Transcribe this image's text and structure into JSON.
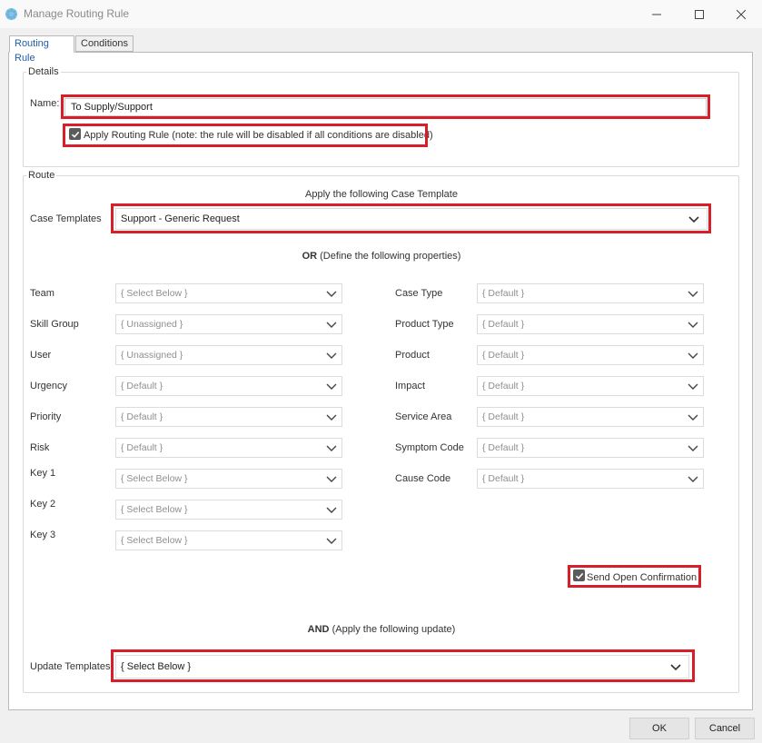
{
  "window": {
    "title": "Manage Routing Rule",
    "controls": {
      "minimize_icon": "minimize-icon",
      "maximize_icon": "maximize-icon",
      "close_icon": "close-icon"
    }
  },
  "tabs": [
    {
      "label": "Routing Rule",
      "active": true
    },
    {
      "label": "Conditions",
      "active": false
    }
  ],
  "details": {
    "group_label": "Details",
    "name_label": "Name:",
    "name_value": "To Supply/Support",
    "apply_label": "Apply Routing Rule (note: the rule will be disabled if all conditions are disabled)",
    "apply_checked": true
  },
  "route": {
    "group_label": "Route",
    "apply_template_heading": "Apply the following Case Template",
    "case_templates_label": "Case Templates",
    "case_templates_value": "Support - Generic Request",
    "or_bold": "OR",
    "or_rest": " (Define the following properties)",
    "left_fields": [
      {
        "label": "Team",
        "value": "{ Select Below }"
      },
      {
        "label": "Skill Group",
        "value": "{ Unassigned }"
      },
      {
        "label": "User",
        "value": "{ Unassigned }"
      },
      {
        "label": "Urgency",
        "value": "{ Default }"
      },
      {
        "label": "Priority",
        "value": "{ Default }"
      },
      {
        "label": "Risk",
        "value": "{ Default }"
      },
      {
        "label": "Key 1",
        "value": "{ Select Below }"
      },
      {
        "label": "Key 2",
        "value": "{ Select Below }"
      },
      {
        "label": "Key 3",
        "value": "{ Select Below }"
      }
    ],
    "right_fields": [
      {
        "label": "Case Type",
        "value": "{ Default }"
      },
      {
        "label": "Product Type",
        "value": "{ Default }"
      },
      {
        "label": "Product",
        "value": "{ Default }"
      },
      {
        "label": "Impact",
        "value": "{ Default }"
      },
      {
        "label": "Service Area",
        "value": "{ Default }"
      },
      {
        "label": "Symptom Code",
        "value": "{ Default }"
      },
      {
        "label": "Cause Code",
        "value": "{ Default }"
      }
    ],
    "send_open_confirmation_label": "Send Open Confirmation",
    "send_open_confirmation_checked": true,
    "and_bold": "AND",
    "and_rest": " (Apply the following update)",
    "update_templates_label": "Update Templates",
    "update_templates_value": "{ Select Below }"
  },
  "buttons": {
    "ok": "OK",
    "cancel": "Cancel"
  },
  "colors": {
    "highlight": "#d81e28",
    "accent": "#1e5faa",
    "app_icon": "#5aa9d6"
  }
}
